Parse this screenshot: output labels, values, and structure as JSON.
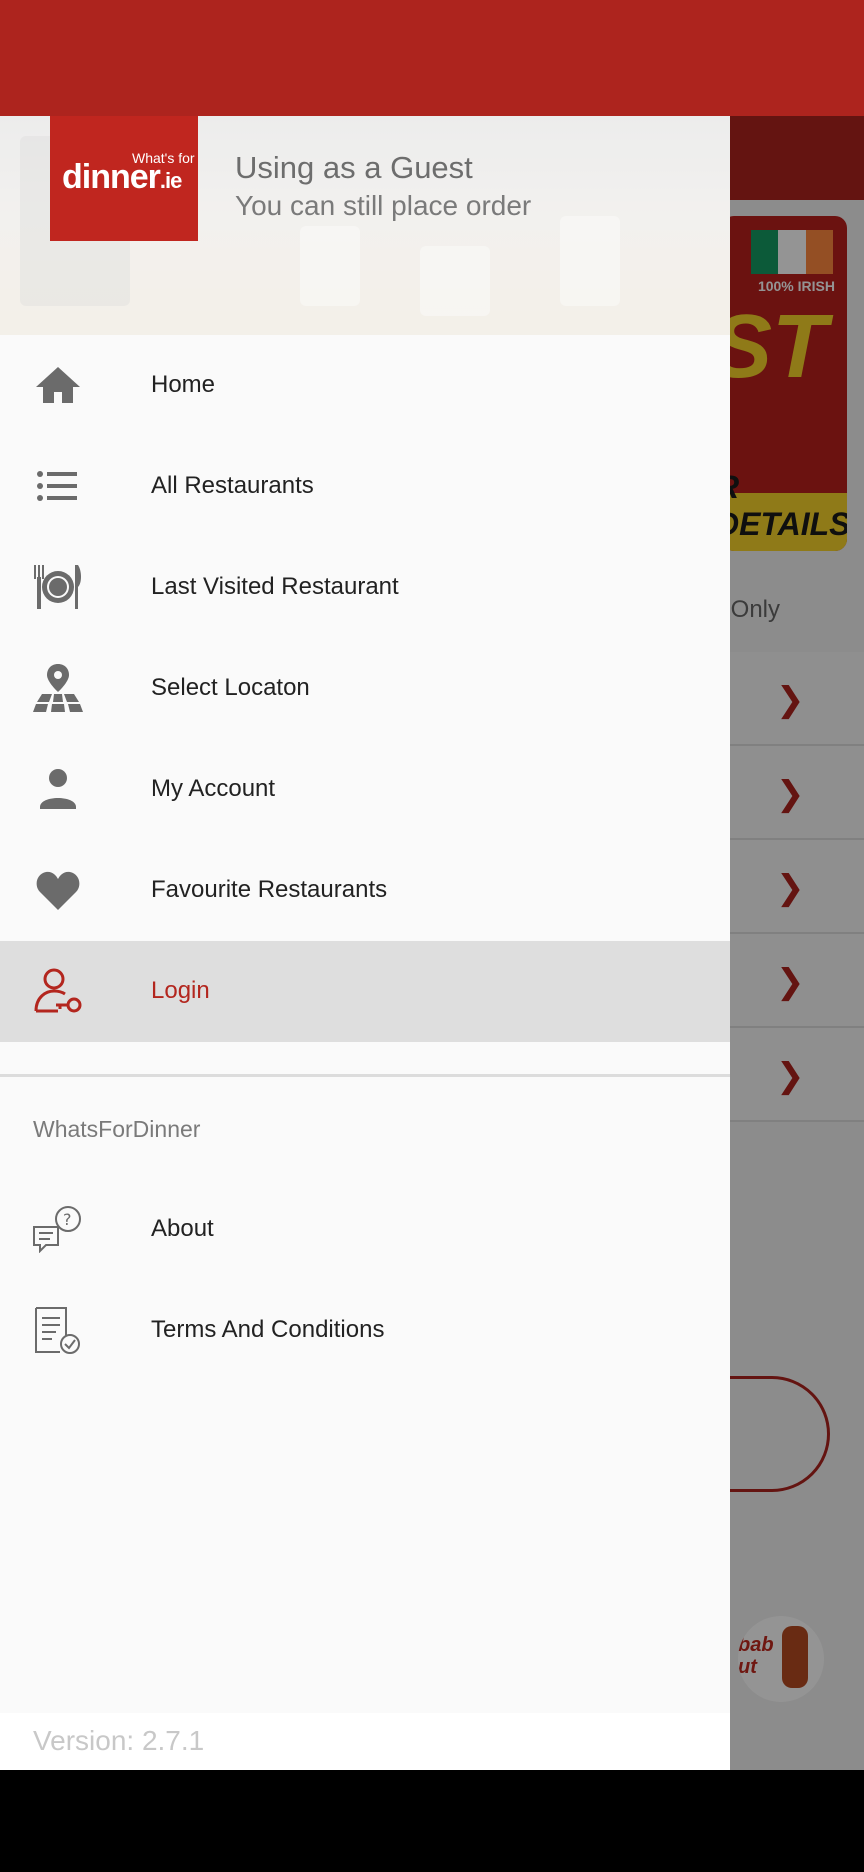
{
  "header": {
    "logo_small": "What's for",
    "logo_main": "dinner",
    "logo_suffix": ".ie",
    "guest_title": "Using as a Guest",
    "guest_subtitle": "You can still place order"
  },
  "menu": {
    "items": [
      {
        "label": "Home",
        "icon": "home-icon"
      },
      {
        "label": "All Restaurants",
        "icon": "list-icon"
      },
      {
        "label": "Last Visited Restaurant",
        "icon": "dining-plate-icon"
      },
      {
        "label": "Select Locaton",
        "icon": "map-pin-icon"
      },
      {
        "label": "My Account",
        "icon": "person-icon"
      },
      {
        "label": "Favourite Restaurants",
        "icon": "heart-icon"
      },
      {
        "label": "Login",
        "icon": "user-key-icon",
        "active": true
      }
    ],
    "section_title": "WhatsForDinner",
    "section_items": [
      {
        "label": "About",
        "icon": "chat-question-icon"
      },
      {
        "label": "Terms And Conditions",
        "icon": "document-check-icon"
      }
    ]
  },
  "footer": {
    "version": "Version: 2.7.1"
  },
  "background": {
    "banner_irish": "100% IRISH",
    "banner_big": "ST",
    "banner_details": "R DETAILS",
    "only_text": "y Only",
    "avatar_text": "bab\nut"
  },
  "colors": {
    "brand": "#ad241e",
    "active_text": "#b3261e",
    "icon_gray": "#6b6b6b"
  }
}
